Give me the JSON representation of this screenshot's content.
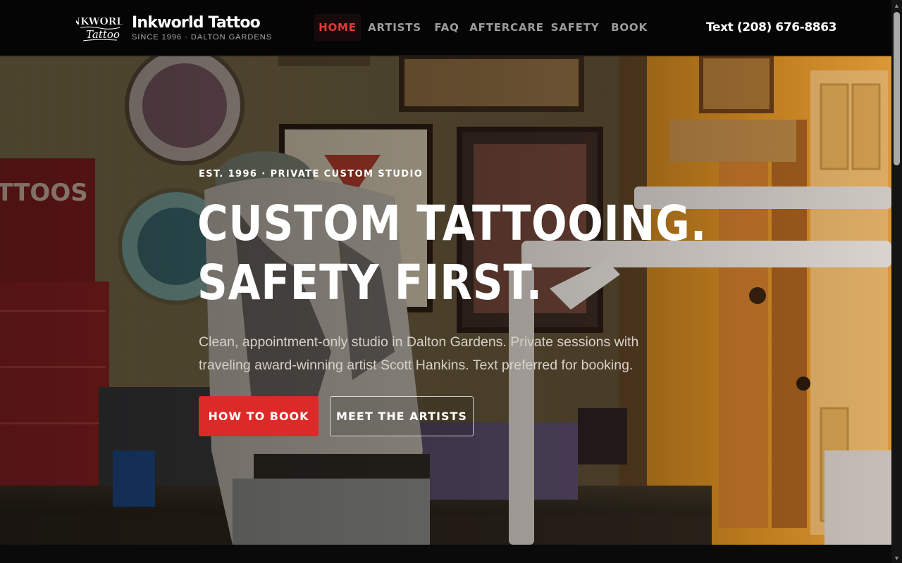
{
  "brand": {
    "logo_text": "INKWORLD Tattoo",
    "name": "Inkworld Tattoo",
    "tagline": "SINCE 1996 · DALTON GARDENS"
  },
  "nav": {
    "items": [
      {
        "label": "HOME",
        "active": true
      },
      {
        "label": "ARTISTS",
        "active": false
      },
      {
        "label": "FAQ",
        "active": false
      },
      {
        "label": "AFTERCARE",
        "active": false
      },
      {
        "label": "SAFETY",
        "active": false
      },
      {
        "label": "BOOK",
        "active": false
      }
    ]
  },
  "phone": {
    "label": "Text (208) 676-8863"
  },
  "hero": {
    "eyebrow": "EST. 1996 · PRIVATE CUSTOM STUDIO",
    "headline_line1": "CUSTOM TATTOOING.",
    "headline_line2": "SAFETY FIRST.",
    "subtext": "Clean, appointment-only studio in Dalton Gardens. Private sessions with traveling award-winning artist Scott Hankins. Text preferred for booking.",
    "primary_button": "HOW TO BOOK",
    "secondary_button": "MEET THE ARTISTS",
    "background_image": "tattoo studio interior photo"
  },
  "colors": {
    "accent": "#dc2a28",
    "header_bg": "#050505",
    "nav_active": "#e23a34",
    "nav_inactive": "#9c9c9c"
  }
}
